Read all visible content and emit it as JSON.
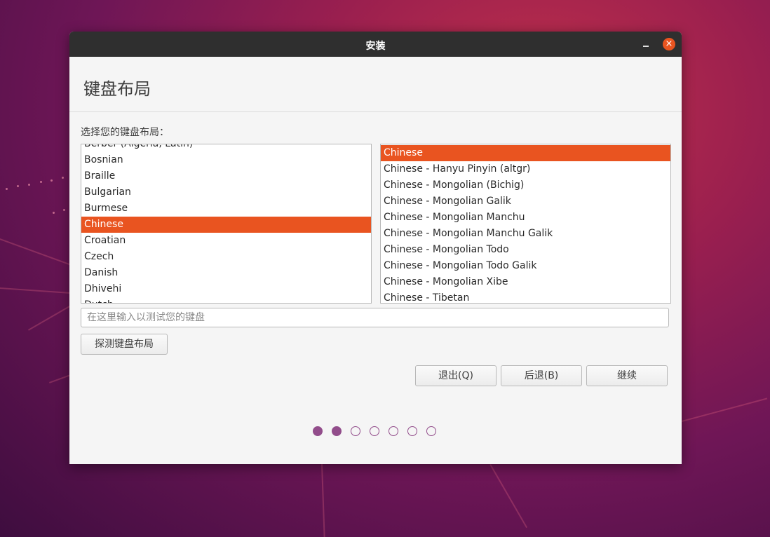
{
  "window": {
    "title": "安装",
    "minimize_label": "–",
    "close_label": "×"
  },
  "page": {
    "title": "键盘布局",
    "prompt": "选择您的键盘布局："
  },
  "layouts": {
    "items": [
      "Berber (Algeria, Latin)",
      "Bosnian",
      "Braille",
      "Bulgarian",
      "Burmese",
      "Chinese",
      "Croatian",
      "Czech",
      "Danish",
      "Dhivehi",
      "Dutch"
    ],
    "selected": "Chinese"
  },
  "variants": {
    "items": [
      "Chinese",
      "Chinese - Hanyu Pinyin (altgr)",
      "Chinese - Mongolian (Bichig)",
      "Chinese - Mongolian Galik",
      "Chinese - Mongolian Manchu",
      "Chinese - Mongolian Manchu Galik",
      "Chinese - Mongolian Todo",
      "Chinese - Mongolian Todo Galik",
      "Chinese - Mongolian Xibe",
      "Chinese - Tibetan"
    ],
    "selected": "Chinese"
  },
  "test_input": {
    "value": "",
    "placeholder": "在这里输入以测试您的键盘"
  },
  "buttons": {
    "detect": "探测键盘布局",
    "quit": "退出(Q)",
    "back": "后退(B)",
    "continue": "继续"
  },
  "progress": {
    "total": 7,
    "completed": 2
  },
  "colors": {
    "accent": "#e95420",
    "progress": "#924d8b",
    "titlebar": "#2f2f2f"
  }
}
